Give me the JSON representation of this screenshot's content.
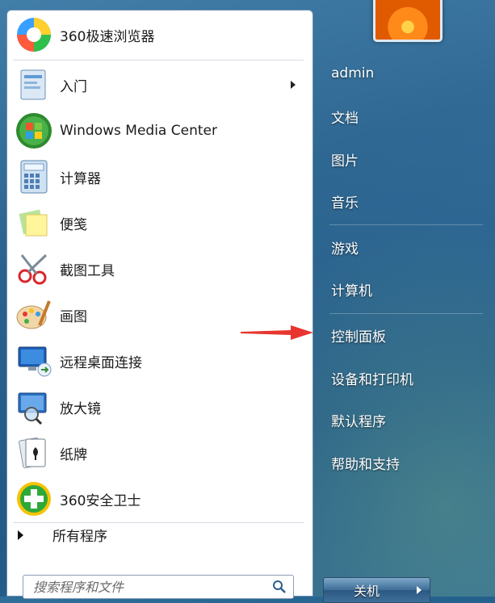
{
  "programs": [
    {
      "label": "360极速浏览器",
      "icon": "360-browser-icon"
    },
    {
      "label": "入门",
      "icon": "getting-started-icon"
    },
    {
      "label": "Windows Media Center",
      "icon": "windows-media-center-icon"
    },
    {
      "label": "计算器",
      "icon": "calculator-icon"
    },
    {
      "label": "便笺",
      "icon": "sticky-notes-icon"
    },
    {
      "label": "截图工具",
      "icon": "snipping-tool-icon"
    },
    {
      "label": "画图",
      "icon": "paint-icon"
    },
    {
      "label": "远程桌面连接",
      "icon": "remote-desktop-icon"
    },
    {
      "label": "放大镜",
      "icon": "magnifier-icon"
    },
    {
      "label": "纸牌",
      "icon": "solitaire-icon"
    },
    {
      "label": "360安全卫士",
      "icon": "360-safe-icon"
    }
  ],
  "all_programs_label": "所有程序",
  "search": {
    "placeholder": "搜索程序和文件"
  },
  "right": {
    "user": "admin",
    "items": [
      "文档",
      "图片",
      "音乐",
      "游戏",
      "计算机",
      "控制面板",
      "设备和打印机",
      "默认程序",
      "帮助和支持"
    ]
  },
  "shutdown_label": "关机",
  "colors": {
    "annotation_arrow": "#e8362f",
    "taskbar_blue": "#235f8c"
  }
}
